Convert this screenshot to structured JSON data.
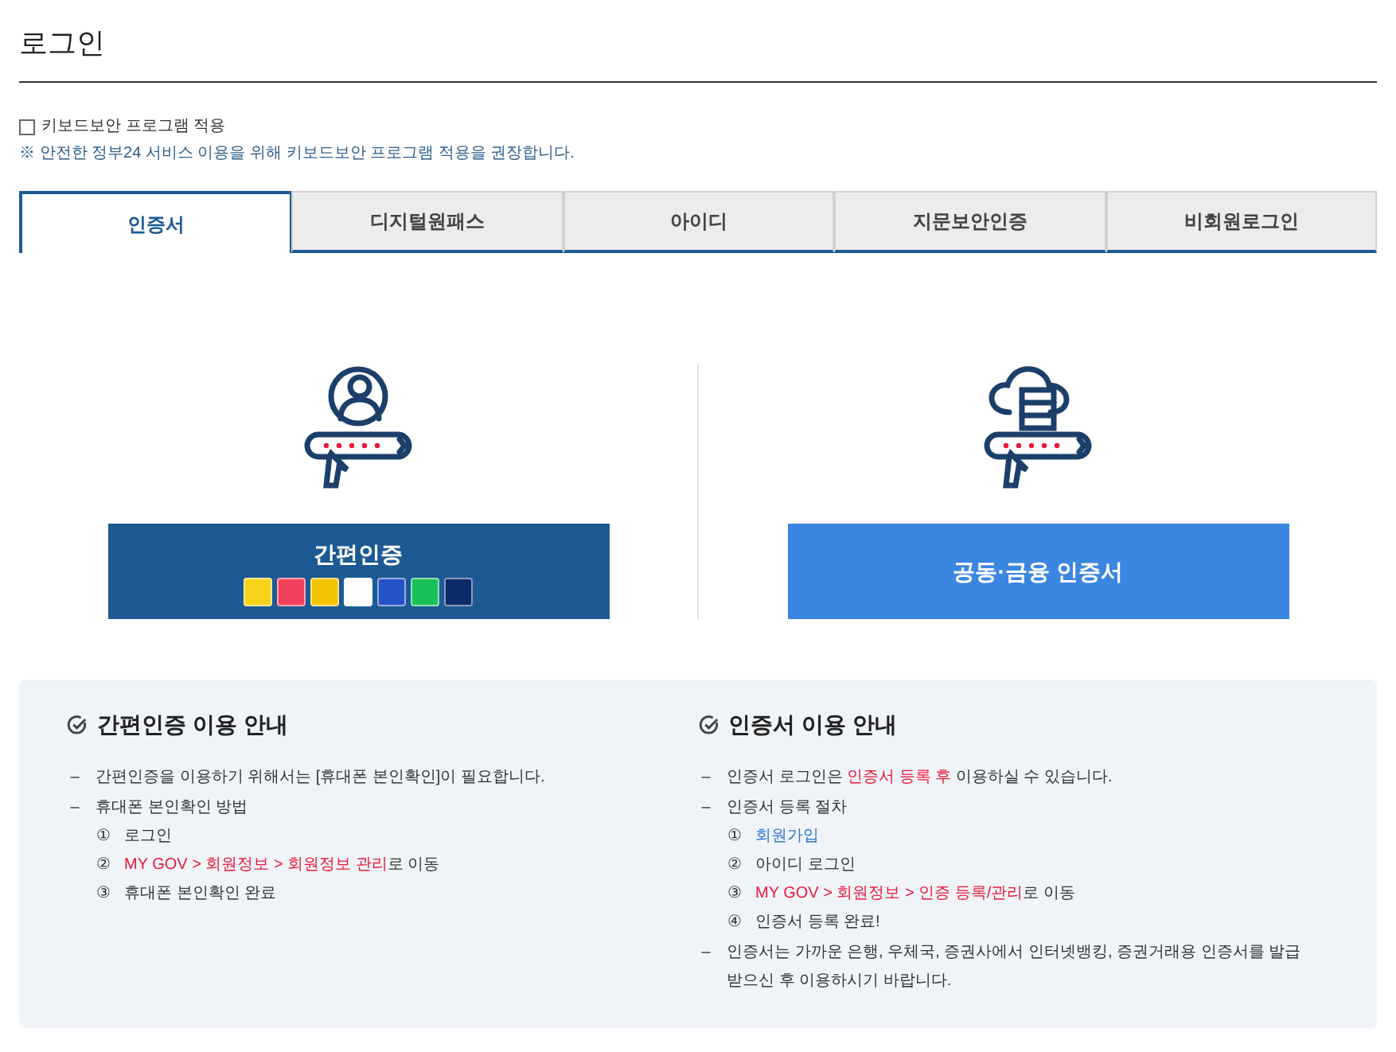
{
  "page_title": "로그인",
  "keyboard_security": {
    "label": "키보드보안 프로그램 적용",
    "checked": false,
    "note": "※ 안전한 정부24 서비스 이용을 위해 키보드보안 프로그램 적용을 권장합니다."
  },
  "tabs": [
    {
      "label": "인증서",
      "selected": true
    },
    {
      "label": "디지털원패스",
      "selected": false
    },
    {
      "label": "아이디",
      "selected": false
    },
    {
      "label": "지문보안인증",
      "selected": false
    },
    {
      "label": "비회원로그인",
      "selected": false
    }
  ],
  "methods": [
    {
      "kind": "simple",
      "label": "간편인증",
      "providers": [
        {
          "color": "#f7d31a"
        },
        {
          "color": "#f0405a"
        },
        {
          "color": "#f5c400"
        },
        {
          "color": "#ffffff"
        },
        {
          "color": "#2553c6"
        },
        {
          "color": "#19c15a"
        },
        {
          "color": "#0c2a6b"
        }
      ]
    },
    {
      "kind": "certificate",
      "label": "공동·금융 인증서"
    }
  ],
  "guides": [
    {
      "title": "간편인증 이용 안내",
      "items": [
        {
          "marker": "–",
          "segments": [
            {
              "kind": "plain",
              "text": "간편인증을 이용하기 위해서는 [휴대폰 본인확인]이 필요합니다."
            }
          ]
        },
        {
          "marker": "–",
          "segments": [
            {
              "kind": "plain",
              "text": "휴대폰 본인확인 방법"
            }
          ],
          "children": [
            {
              "marker": "①",
              "segments": [
                {
                  "kind": "plain",
                  "text": "로그인"
                }
              ]
            },
            {
              "marker": "②",
              "segments": [
                {
                  "kind": "highlight",
                  "text": "MY GOV > 회원정보 > 회원정보 관리"
                },
                {
                  "kind": "plain",
                  "text": "로 이동"
                }
              ]
            },
            {
              "marker": "③",
              "segments": [
                {
                  "kind": "plain",
                  "text": "휴대폰 본인확인 완료"
                }
              ]
            }
          ]
        }
      ]
    },
    {
      "title": "인증서 이용 안내",
      "items": [
        {
          "marker": "–",
          "segments": [
            {
              "kind": "plain",
              "text": "인증서 로그인은 "
            },
            {
              "kind": "highlight",
              "text": "인증서 등록 후"
            },
            {
              "kind": "plain",
              "text": " 이용하실 수 있습니다."
            }
          ]
        },
        {
          "marker": "–",
          "segments": [
            {
              "kind": "plain",
              "text": "인증서 등록 절차"
            }
          ],
          "children": [
            {
              "marker": "①",
              "segments": [
                {
                  "kind": "link",
                  "text": "회원가입"
                }
              ]
            },
            {
              "marker": "②",
              "segments": [
                {
                  "kind": "plain",
                  "text": "아이디 로그인"
                }
              ]
            },
            {
              "marker": "③",
              "segments": [
                {
                  "kind": "highlight",
                  "text": "MY GOV > 회원정보 > 인증 등록/관리"
                },
                {
                  "kind": "plain",
                  "text": "로 이동"
                }
              ]
            },
            {
              "marker": "④",
              "segments": [
                {
                  "kind": "plain",
                  "text": "인증서 등록 완료!"
                }
              ]
            }
          ]
        },
        {
          "marker": "–",
          "segments": [
            {
              "kind": "plain",
              "text": "인증서는 가까운 은행, 우체국, 증권사에서 인터넷뱅킹, 증권거래용 인증서를 발급받으신 후 이용하시기 바랍니다."
            }
          ]
        }
      ]
    }
  ]
}
